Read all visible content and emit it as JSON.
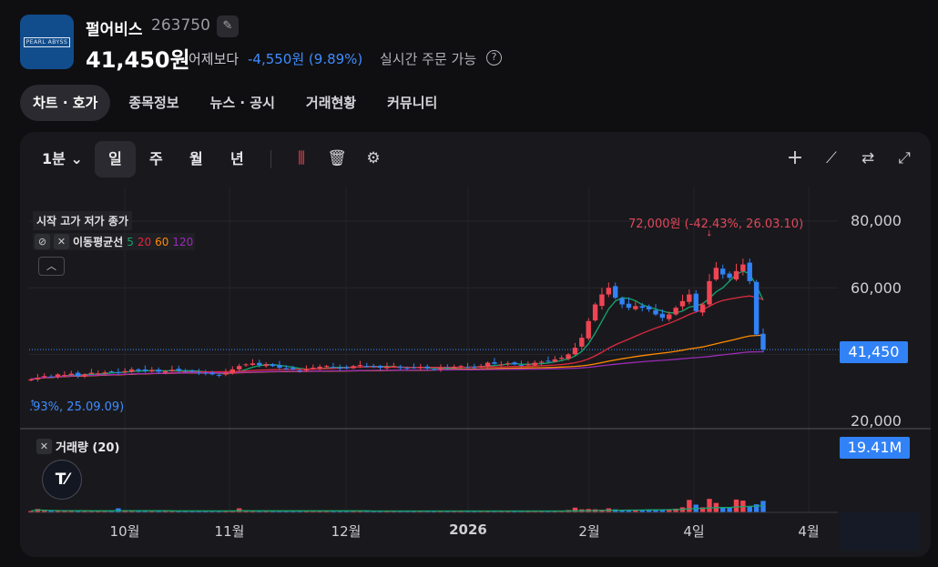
{
  "stock": {
    "logo_text": "PEARL ABYSS",
    "name": "펄어비스",
    "code": "263750",
    "price": "41,450원",
    "vs_label": "어제보다",
    "change": "-4,550원 (9.89%)",
    "realtime": "실시간 주문 가능",
    "help": "?"
  },
  "tabs": [
    {
      "label": "차트 · 호가"
    },
    {
      "label": "종목정보"
    },
    {
      "label": "뉴스 · 공시"
    },
    {
      "label": "거래현황"
    },
    {
      "label": "커뮤니티"
    }
  ],
  "toolbar": {
    "interval": "1분",
    "periods": [
      "일",
      "주",
      "월",
      "년"
    ]
  },
  "legend": {
    "ohlc": "시작 고가 저가 종가",
    "ma_label": "이동평균선",
    "ma": [
      "5",
      "20",
      "60",
      "120"
    ],
    "volume": "거래량 (20)",
    "tv_logo": "TV"
  },
  "colors": {
    "up": "#f04452",
    "down": "#3182f6",
    "ma5": "#17a56b",
    "ma20": "#e0293f",
    "ma60": "#ff8a00",
    "ma120": "#9b2bb5"
  },
  "annotations": {
    "high": "72,000원 (-42.43%, 26.03.10)",
    "low": ".93%, 25.09.09)"
  },
  "chart_data": {
    "type": "candlestick",
    "y_ticks": [
      "80,000",
      "60,000",
      "20,000"
    ],
    "y_tick_values": [
      80000,
      60000,
      20000
    ],
    "ylim": [
      17000,
      88000
    ],
    "x_labels": [
      "10월",
      "11월",
      "12월",
      "2026",
      "2월",
      "4일",
      "4월"
    ],
    "last_price": "41,450",
    "last_volume": "19.41M",
    "closes": [
      32.5,
      33,
      33.5,
      33.2,
      34,
      33.8,
      34.2,
      33.5,
      34,
      34.5,
      34.3,
      34.6,
      34.8,
      34.5,
      35,
      35.5,
      35.2,
      35,
      35.3,
      34.8,
      35,
      35.4,
      35.2,
      35,
      34.8,
      34.5,
      34.2,
      34,
      33.8,
      34.5,
      35.5,
      36.5,
      37,
      37.3,
      36.8,
      37,
      36.5,
      36,
      35.8,
      35.5,
      35.2,
      35.5,
      36,
      36.3,
      36.5,
      36,
      35.8,
      36,
      36.5,
      36.8,
      36.5,
      36.2,
      36,
      36.3,
      36.5,
      36,
      35.8,
      36,
      36.2,
      35.8,
      35.5,
      35.8,
      36,
      36.3,
      36.5,
      36.2,
      36,
      36.5,
      37.5,
      37.2,
      37,
      37.3,
      37,
      36.8,
      37,
      37.5,
      37.8,
      38,
      38.5,
      39,
      40,
      42,
      45,
      50,
      55,
      58,
      60,
      57,
      55,
      54,
      54.5,
      54,
      53.5,
      52,
      51,
      52,
      54,
      56,
      58,
      53,
      55,
      62,
      66,
      64,
      63,
      65,
      67,
      62,
      46,
      41.45
    ],
    "volumes_m": [
      0.4,
      1,
      0.5,
      0.4,
      0.4,
      0.4,
      0.4,
      0.4,
      0.4,
      0.4,
      0.4,
      0.4,
      0.4,
      1.2,
      0.4,
      0.4,
      0.4,
      0.4,
      0.4,
      0.4,
      0.4,
      0.4,
      0.4,
      0.4,
      0.4,
      0.4,
      0.4,
      0.4,
      0.4,
      0.4,
      0.4,
      1.2,
      0.5,
      0.4,
      0.4,
      0.4,
      0.4,
      0.4,
      0.4,
      0.4,
      0.4,
      0.4,
      0.4,
      0.4,
      0.4,
      0.4,
      0.4,
      0.4,
      0.4,
      0.4,
      0.4,
      0.4,
      0.4,
      0.4,
      0.4,
      0.4,
      0.4,
      0.4,
      0.4,
      0.4,
      0.4,
      0.4,
      0.4,
      0.4,
      0.4,
      0.4,
      0.4,
      0.4,
      0.4,
      0.4,
      0.4,
      0.4,
      0.4,
      0.4,
      0.4,
      0.4,
      0.4,
      0.4,
      0.4,
      0.5,
      0.7,
      1.4,
      0.9,
      1,
      0.9,
      0.8,
      1.2,
      0.9,
      0.8,
      0.7,
      0.7,
      0.8,
      0.9,
      0.9,
      0.8,
      0.9,
      1.1,
      1.5,
      3.7,
      2.3,
      1.5,
      4,
      2.8,
      1.5,
      1.5,
      3.8,
      3.5,
      1.8,
      2.4,
      3.4,
      2.8,
      11,
      19.41
    ]
  }
}
